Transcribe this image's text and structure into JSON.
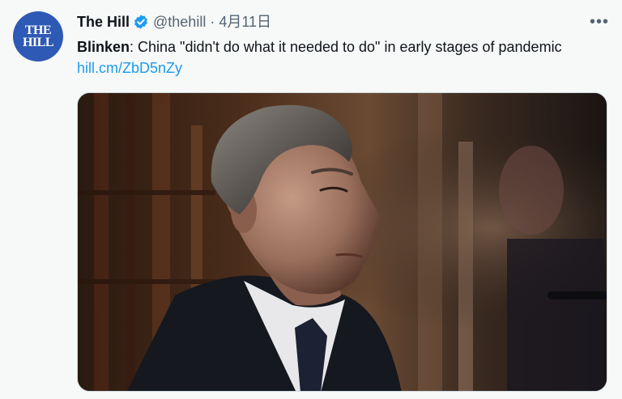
{
  "tweet": {
    "avatar_text_line1": "THE",
    "avatar_text_line2": "HILL",
    "author_name": "The Hill",
    "handle": "@thehill",
    "separator": "·",
    "date": "4月11日",
    "more_icon": "more-icon",
    "text_bold": "Blinken",
    "text_rest": ": China \"didn't do what it needed to do\" in early stages of pandemic",
    "link": "hill.cm/ZbD5nZy",
    "colors": {
      "avatar_bg": "#2e59b5",
      "verified": "#1d9bf0",
      "link": "#1d9bf0"
    }
  }
}
